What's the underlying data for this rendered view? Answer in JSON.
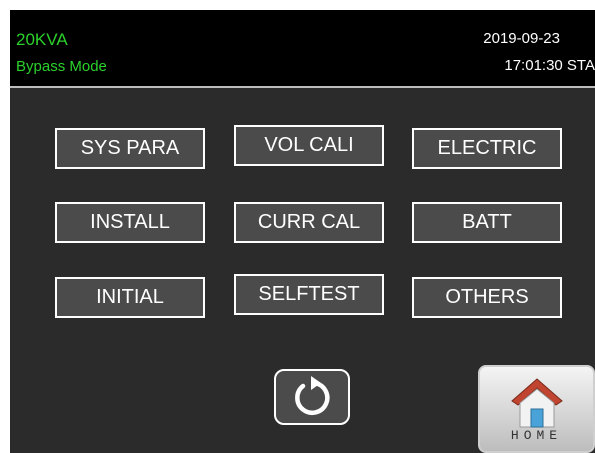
{
  "header": {
    "model": "20KVA",
    "mode": "Bypass Mode",
    "date": "2019-09-23",
    "time": "17:01:30 STA"
  },
  "menu": {
    "buttons": [
      {
        "label": "SYS PARA"
      },
      {
        "label": "VOL CALI"
      },
      {
        "label": "ELECTRIC"
      },
      {
        "label": "INSTALL"
      },
      {
        "label": "CURR CAL"
      },
      {
        "label": "BATT"
      },
      {
        "label": "INITIAL"
      },
      {
        "label": "SELFTEST"
      },
      {
        "label": "OTHERS"
      }
    ]
  },
  "footer": {
    "back_icon": "refresh-back-icon",
    "home_icon": "house-icon",
    "home_label": "HOME"
  },
  "colors": {
    "status_green": "#2bd12b",
    "panel_bg": "#2b2b2b",
    "button_bg": "#4b4b4b",
    "roof": "#c0442f",
    "house_window": "#4aa3d8"
  }
}
